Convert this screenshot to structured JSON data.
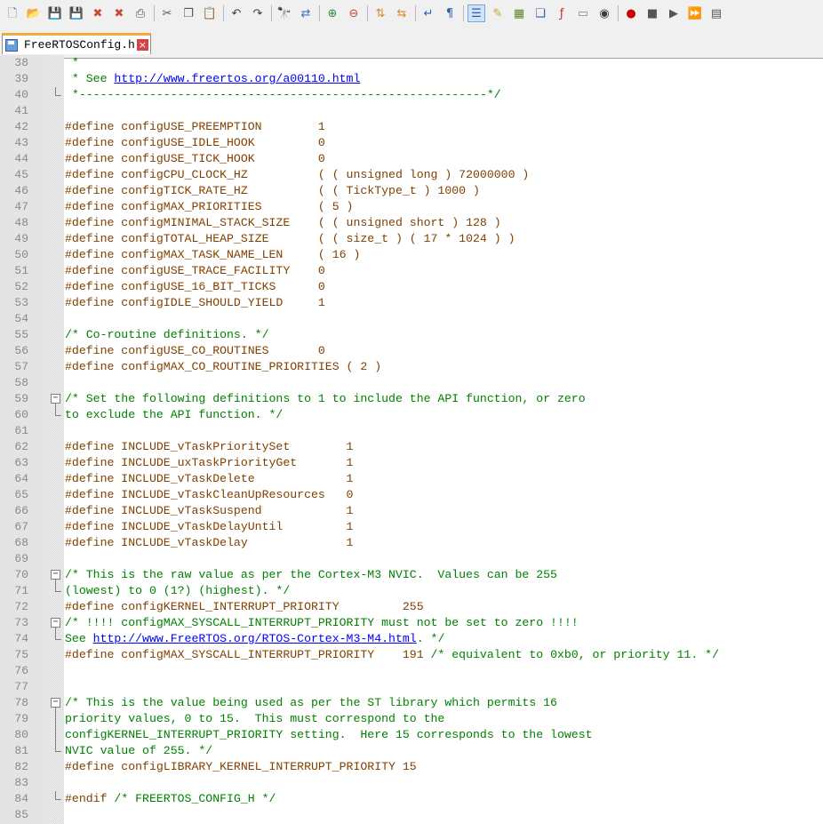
{
  "toolbar": {
    "buttons": [
      {
        "name": "new-file-icon",
        "glyph": "🗋",
        "color": "#4a79c4"
      },
      {
        "name": "open-file-icon",
        "glyph": "📂",
        "color": "#d8a531"
      },
      {
        "name": "save-icon",
        "glyph": "💾",
        "color": "#4b6fa8"
      },
      {
        "name": "save-all-icon",
        "glyph": "💾",
        "color": "#4b6fa8"
      },
      {
        "name": "close-icon",
        "glyph": "✖",
        "color": "#c94b3a"
      },
      {
        "name": "close-all-icon",
        "glyph": "✖",
        "color": "#c94b3a"
      },
      {
        "name": "print-icon",
        "glyph": "⎙",
        "color": "#4f4f4f"
      },
      {
        "name": "cut-icon",
        "glyph": "✂",
        "color": "#555555"
      },
      {
        "name": "copy-icon",
        "glyph": "❐",
        "color": "#555555"
      },
      {
        "name": "paste-icon",
        "glyph": "📋",
        "color": "#a87b2e"
      },
      {
        "name": "undo-icon",
        "glyph": "↶",
        "color": "#3e3e3e"
      },
      {
        "name": "redo-icon",
        "glyph": "↷",
        "color": "#3e3e3e"
      },
      {
        "name": "find-icon",
        "glyph": "🔭",
        "color": "#333333"
      },
      {
        "name": "replace-icon",
        "glyph": "⇄",
        "color": "#3b6fc0"
      },
      {
        "name": "zoom-in-icon",
        "glyph": "⊕",
        "color": "#2e8b3a"
      },
      {
        "name": "zoom-out-icon",
        "glyph": "⊖",
        "color": "#c24a2a"
      },
      {
        "name": "sync-vertical-icon",
        "glyph": "⇅",
        "color": "#d88a2a"
      },
      {
        "name": "sync-horizontal-icon",
        "glyph": "⇆",
        "color": "#d88a2a"
      },
      {
        "name": "word-wrap-icon",
        "glyph": "↵",
        "color": "#2c5ea8"
      },
      {
        "name": "show-all-chars-icon",
        "glyph": "¶",
        "color": "#2c5ea8"
      },
      {
        "name": "indent-guide-icon",
        "glyph": "☰",
        "color": "#2c5ea8",
        "active": true
      },
      {
        "name": "language-icon",
        "glyph": "✎",
        "color": "#d0a030"
      },
      {
        "name": "document-map-icon",
        "glyph": "▦",
        "color": "#5a8a2a"
      },
      {
        "name": "document-list-icon",
        "glyph": "❏",
        "color": "#2c5ea8"
      },
      {
        "name": "function-list-icon",
        "glyph": "ƒ",
        "color": "#c03030"
      },
      {
        "name": "folder-workspace-icon",
        "glyph": "▭",
        "color": "#c07070"
      },
      {
        "name": "monitoring-icon",
        "glyph": "◉",
        "color": "#3a3a3a"
      },
      {
        "name": "record-macro-icon",
        "glyph": "●",
        "color": "#cc0000"
      },
      {
        "name": "stop-macro-icon",
        "glyph": "■",
        "color": "#555555"
      },
      {
        "name": "play-macro-icon",
        "glyph": "▶",
        "color": "#555555"
      },
      {
        "name": "run-macro-multiple-icon",
        "glyph": "⏩",
        "color": "#2c5ea8"
      },
      {
        "name": "save-macro-icon",
        "glyph": "▤",
        "color": "#555555"
      }
    ]
  },
  "tab": {
    "label": "FreeRTOSConfig.h",
    "close_glyph": "×",
    "accent": "#f4a83d"
  },
  "colors": {
    "preprocessor": "#804000",
    "comment": "#008000",
    "url": "#0000ff",
    "line_number": "#8a8a8a"
  },
  "lines": [
    {
      "num": "38",
      "segs": [
        {
          "t": "cm",
          "v": " *"
        }
      ]
    },
    {
      "num": "39",
      "segs": [
        {
          "t": "cm",
          "v": " * See "
        },
        {
          "t": "url",
          "v": "http://www.freertos.org/a00110.html"
        }
      ]
    },
    {
      "num": "40",
      "segs": [
        {
          "t": "cm",
          "v": " *----------------------------------------------------------*/"
        }
      ]
    },
    {
      "num": "41",
      "segs": []
    },
    {
      "num": "42",
      "segs": [
        {
          "t": "pp",
          "v": "#define configUSE_PREEMPTION        1"
        }
      ]
    },
    {
      "num": "43",
      "segs": [
        {
          "t": "pp",
          "v": "#define configUSE_IDLE_HOOK         0"
        }
      ]
    },
    {
      "num": "44",
      "segs": [
        {
          "t": "pp",
          "v": "#define configUSE_TICK_HOOK         0"
        }
      ]
    },
    {
      "num": "45",
      "segs": [
        {
          "t": "pp",
          "v": "#define configCPU_CLOCK_HZ          ( ( unsigned long ) 72000000 )"
        }
      ]
    },
    {
      "num": "46",
      "segs": [
        {
          "t": "pp",
          "v": "#define configTICK_RATE_HZ          ( ( TickType_t ) 1000 )"
        }
      ]
    },
    {
      "num": "47",
      "segs": [
        {
          "t": "pp",
          "v": "#define configMAX_PRIORITIES        ( 5 )"
        }
      ]
    },
    {
      "num": "48",
      "segs": [
        {
          "t": "pp",
          "v": "#define configMINIMAL_STACK_SIZE    ( ( unsigned short ) 128 )"
        }
      ]
    },
    {
      "num": "49",
      "segs": [
        {
          "t": "pp",
          "v": "#define configTOTAL_HEAP_SIZE       ( ( size_t ) ( 17 * 1024 ) )"
        }
      ]
    },
    {
      "num": "50",
      "segs": [
        {
          "t": "pp",
          "v": "#define configMAX_TASK_NAME_LEN     ( 16 )"
        }
      ]
    },
    {
      "num": "51",
      "segs": [
        {
          "t": "pp",
          "v": "#define configUSE_TRACE_FACILITY    0"
        }
      ]
    },
    {
      "num": "52",
      "segs": [
        {
          "t": "pp",
          "v": "#define configUSE_16_BIT_TICKS      0"
        }
      ]
    },
    {
      "num": "53",
      "segs": [
        {
          "t": "pp",
          "v": "#define configIDLE_SHOULD_YIELD     1"
        }
      ]
    },
    {
      "num": "54",
      "segs": []
    },
    {
      "num": "55",
      "segs": [
        {
          "t": "cm",
          "v": "/* Co-routine definitions. */"
        }
      ]
    },
    {
      "num": "56",
      "segs": [
        {
          "t": "pp",
          "v": "#define configUSE_CO_ROUTINES       0"
        }
      ]
    },
    {
      "num": "57",
      "segs": [
        {
          "t": "pp",
          "v": "#define configMAX_CO_ROUTINE_PRIORITIES ( 2 )"
        }
      ]
    },
    {
      "num": "58",
      "segs": []
    },
    {
      "num": "59",
      "segs": [
        {
          "t": "cm",
          "v": "/* Set the following definitions to 1 to include the API function, or zero"
        }
      ]
    },
    {
      "num": "60",
      "segs": [
        {
          "t": "cm",
          "v": "to exclude the API function. */"
        }
      ]
    },
    {
      "num": "61",
      "segs": []
    },
    {
      "num": "62",
      "segs": [
        {
          "t": "pp",
          "v": "#define INCLUDE_vTaskPrioritySet        1"
        }
      ]
    },
    {
      "num": "63",
      "segs": [
        {
          "t": "pp",
          "v": "#define INCLUDE_uxTaskPriorityGet       1"
        }
      ]
    },
    {
      "num": "64",
      "segs": [
        {
          "t": "pp",
          "v": "#define INCLUDE_vTaskDelete             1"
        }
      ]
    },
    {
      "num": "65",
      "segs": [
        {
          "t": "pp",
          "v": "#define INCLUDE_vTaskCleanUpResources   0"
        }
      ]
    },
    {
      "num": "66",
      "segs": [
        {
          "t": "pp",
          "v": "#define INCLUDE_vTaskSuspend            1"
        }
      ]
    },
    {
      "num": "67",
      "segs": [
        {
          "t": "pp",
          "v": "#define INCLUDE_vTaskDelayUntil         1"
        }
      ]
    },
    {
      "num": "68",
      "segs": [
        {
          "t": "pp",
          "v": "#define INCLUDE_vTaskDelay              1"
        }
      ]
    },
    {
      "num": "69",
      "segs": []
    },
    {
      "num": "70",
      "segs": [
        {
          "t": "cm",
          "v": "/* This is the raw value as per the Cortex-M3 NVIC.  Values can be 255"
        }
      ]
    },
    {
      "num": "71",
      "segs": [
        {
          "t": "cm",
          "v": "(lowest) to 0 (1?) (highest). */"
        }
      ]
    },
    {
      "num": "72",
      "segs": [
        {
          "t": "pp",
          "v": "#define configKERNEL_INTERRUPT_PRIORITY         255"
        }
      ]
    },
    {
      "num": "73",
      "segs": [
        {
          "t": "cm",
          "v": "/* !!!! configMAX_SYSCALL_INTERRUPT_PRIORITY must not be set to zero !!!!"
        }
      ]
    },
    {
      "num": "74",
      "segs": [
        {
          "t": "cm",
          "v": "See "
        },
        {
          "t": "url",
          "v": "http://www.FreeRTOS.org/RTOS-Cortex-M3-M4.html"
        },
        {
          "t": "cm",
          "v": ". */"
        }
      ]
    },
    {
      "num": "75",
      "segs": [
        {
          "t": "pp",
          "v": "#define configMAX_SYSCALL_INTERRUPT_PRIORITY    191 "
        },
        {
          "t": "cm",
          "v": "/* equivalent to 0xb0, or priority 11. */"
        }
      ]
    },
    {
      "num": "76",
      "segs": []
    },
    {
      "num": "77",
      "segs": []
    },
    {
      "num": "78",
      "segs": [
        {
          "t": "cm",
          "v": "/* This is the value being used as per the ST library which permits 16"
        }
      ]
    },
    {
      "num": "79",
      "segs": [
        {
          "t": "cm",
          "v": "priority values, 0 to 15.  This must correspond to the"
        }
      ]
    },
    {
      "num": "80",
      "segs": [
        {
          "t": "cm",
          "v": "configKERNEL_INTERRUPT_PRIORITY setting.  Here 15 corresponds to the lowest"
        }
      ]
    },
    {
      "num": "81",
      "segs": [
        {
          "t": "cm",
          "v": "NVIC value of 255. */"
        }
      ]
    },
    {
      "num": "82",
      "segs": [
        {
          "t": "pp",
          "v": "#define configLIBRARY_KERNEL_INTERRUPT_PRIORITY 15"
        }
      ]
    },
    {
      "num": "83",
      "segs": []
    },
    {
      "num": "84",
      "segs": [
        {
          "t": "pp",
          "v": "#endif "
        },
        {
          "t": "cm",
          "v": "/* FREERTOS_CONFIG_H */"
        }
      ]
    },
    {
      "num": "85",
      "segs": []
    }
  ],
  "folds": [
    {
      "line": "59",
      "span": 2
    },
    {
      "line": "70",
      "span": 2
    },
    {
      "line": "73",
      "span": 2
    },
    {
      "line": "78",
      "span": 4
    }
  ],
  "fold_ends": [
    "40",
    "84"
  ]
}
